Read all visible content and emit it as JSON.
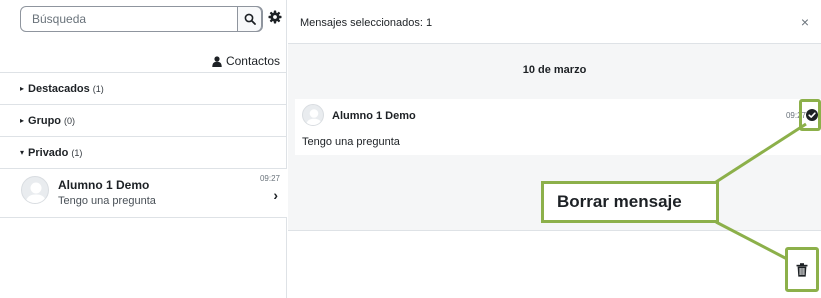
{
  "search": {
    "placeholder": "Búsqueda"
  },
  "contacts_label": "Contactos",
  "sections": [
    {
      "name": "Destacados",
      "count": "(1)",
      "caret": "▸"
    },
    {
      "name": "Grupo",
      "count": "(0)",
      "caret": "▸"
    },
    {
      "name": "Privado",
      "count": "(1)",
      "caret": "▾"
    }
  ],
  "conversation": {
    "name": "Alumno 1 Demo",
    "snippet": "Tengo una pregunta",
    "time": "09:27"
  },
  "header": {
    "selected_text": "Mensajes seleccionados: 1",
    "close": "×"
  },
  "thread": {
    "date": "10 de marzo",
    "message": {
      "sender": "Alumno 1 Demo",
      "text": "Tengo una pregunta",
      "time": "09:27"
    }
  },
  "annotation": {
    "label": "Borrar mensaje",
    "color": "#8cb04a"
  }
}
